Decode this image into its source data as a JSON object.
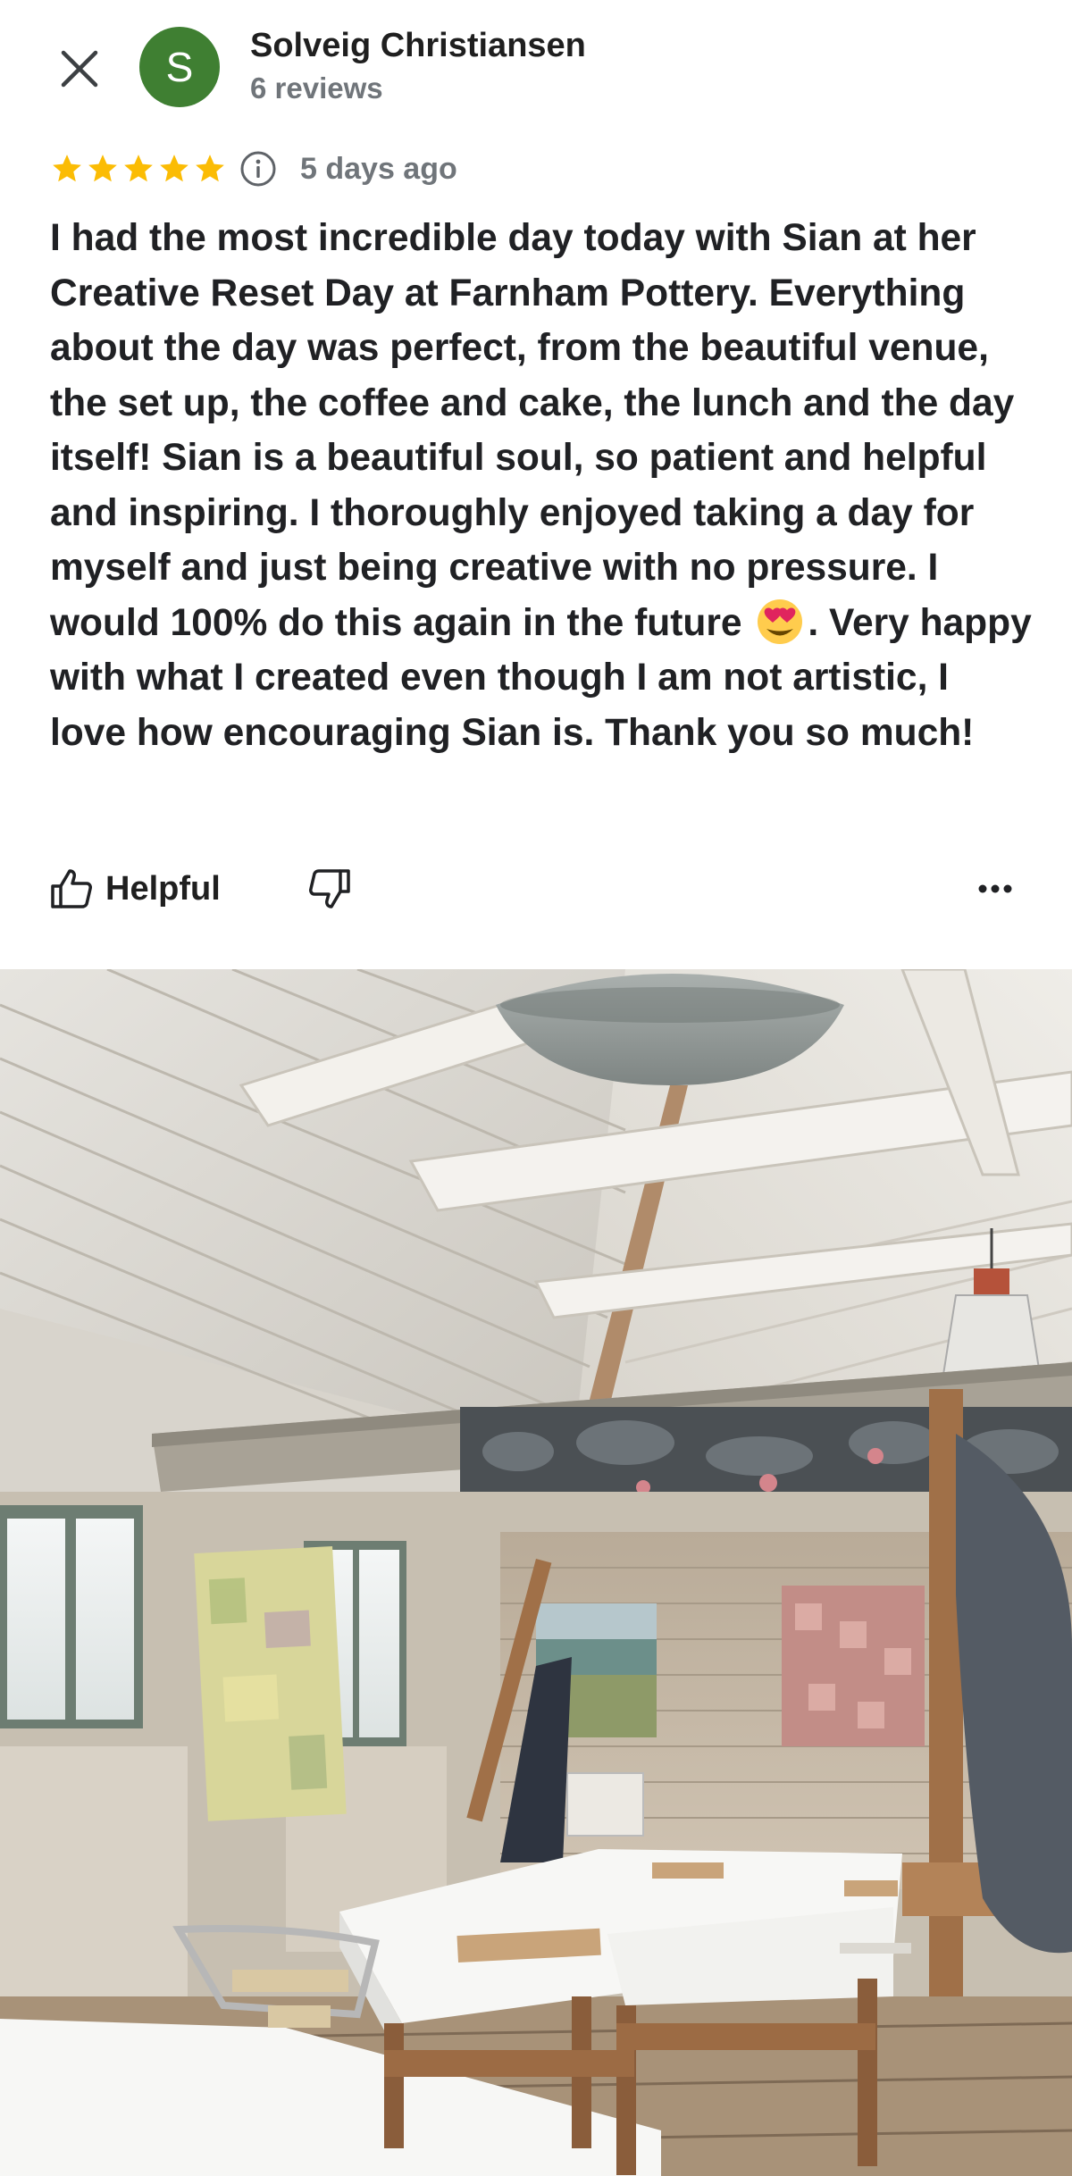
{
  "review": {
    "avatar_initial": "S",
    "avatar_color": "#3f7f32",
    "reviewer_name": "Solveig Christiansen",
    "review_count": "6 reviews",
    "rating": 5,
    "star_color": "#fbbc04",
    "date": "5 days ago",
    "text_before_emoji": "I had the most incredible day today with Sian at her Creative Reset Day at Farnham Pottery. Everything about the day was perfect, from the beautiful venue, the set up, the coffee and cake, the lunch and the day itself! Sian is a beautiful soul, so patient and helpful and inspiring. I thoroughly enjoyed taking a day for myself and just being creative with no pressure. I would 100% do this again in the future",
    "emoji": "smiling-face-with-heart-eyes",
    "text_after_emoji": ". Very happy with what I created even though I am not artistic, I love how encouraging Sian is. Thank you so much!"
  },
  "actions": {
    "helpful_label": "Helpful",
    "like_icon": "thumbs-up-icon",
    "dislike_icon": "thumbs-down-icon",
    "more_icon": "more-horizontal-icon"
  },
  "header": {
    "close_icon": "close-icon"
  },
  "photo": {
    "subject": "art-studio-interior"
  }
}
